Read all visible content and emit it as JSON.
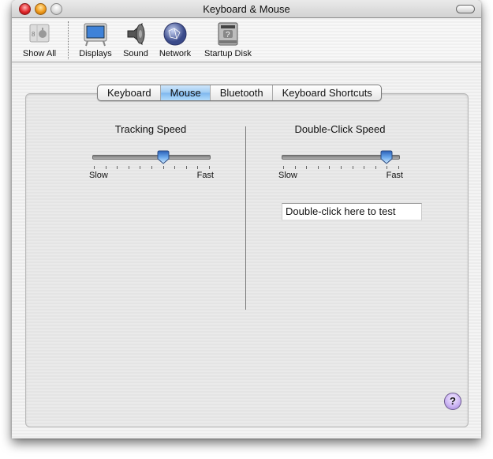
{
  "window": {
    "title": "Keyboard & Mouse"
  },
  "toolbar": {
    "items": [
      {
        "label": "Show All",
        "icon": "show-all-icon"
      },
      {
        "label": "Displays",
        "icon": "display-icon"
      },
      {
        "label": "Sound",
        "icon": "speaker-icon"
      },
      {
        "label": "Network",
        "icon": "network-globe-icon"
      },
      {
        "label": "Startup Disk",
        "icon": "hard-disk-icon"
      }
    ]
  },
  "tabs": [
    {
      "label": "Keyboard",
      "active": false
    },
    {
      "label": "Mouse",
      "active": true
    },
    {
      "label": "Bluetooth",
      "active": false
    },
    {
      "label": "Keyboard Shortcuts",
      "active": false
    }
  ],
  "tracking": {
    "title": "Tracking Speed",
    "min_label": "Slow",
    "max_label": "Fast",
    "ticks": 11,
    "value": 0.6
  },
  "double_click": {
    "title": "Double-Click Speed",
    "min_label": "Slow",
    "max_label": "Fast",
    "ticks": 11,
    "value": 0.9,
    "test_field_text": "Double-click here to test"
  },
  "help": {
    "label": "?"
  }
}
